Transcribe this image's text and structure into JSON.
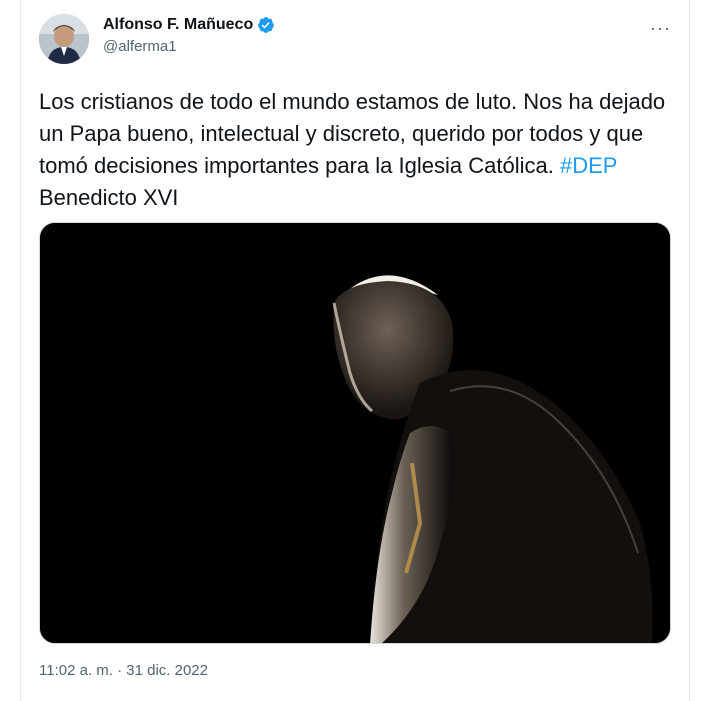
{
  "tweet": {
    "author": {
      "display_name": "Alfonso F. Mañueco",
      "handle": "@alferma1",
      "verified": true
    },
    "more_label": "···",
    "text_main": "Los cristianos de todo el mundo estamos de luto. Nos ha dejado un Papa bueno, intelectual y discreto, querido por todos y que tomó decisiones importantes para la Iglesia Católica.",
    "hashtag": "#DEP",
    "text_tail": "Benedicto XVI",
    "timestamp": "11:02 a. m. · 31 dic. 2022"
  },
  "colors": {
    "link": "#1d9bf0",
    "text": "#0f1419",
    "muted": "#536471",
    "verified_badge": "#1d9bf0"
  }
}
